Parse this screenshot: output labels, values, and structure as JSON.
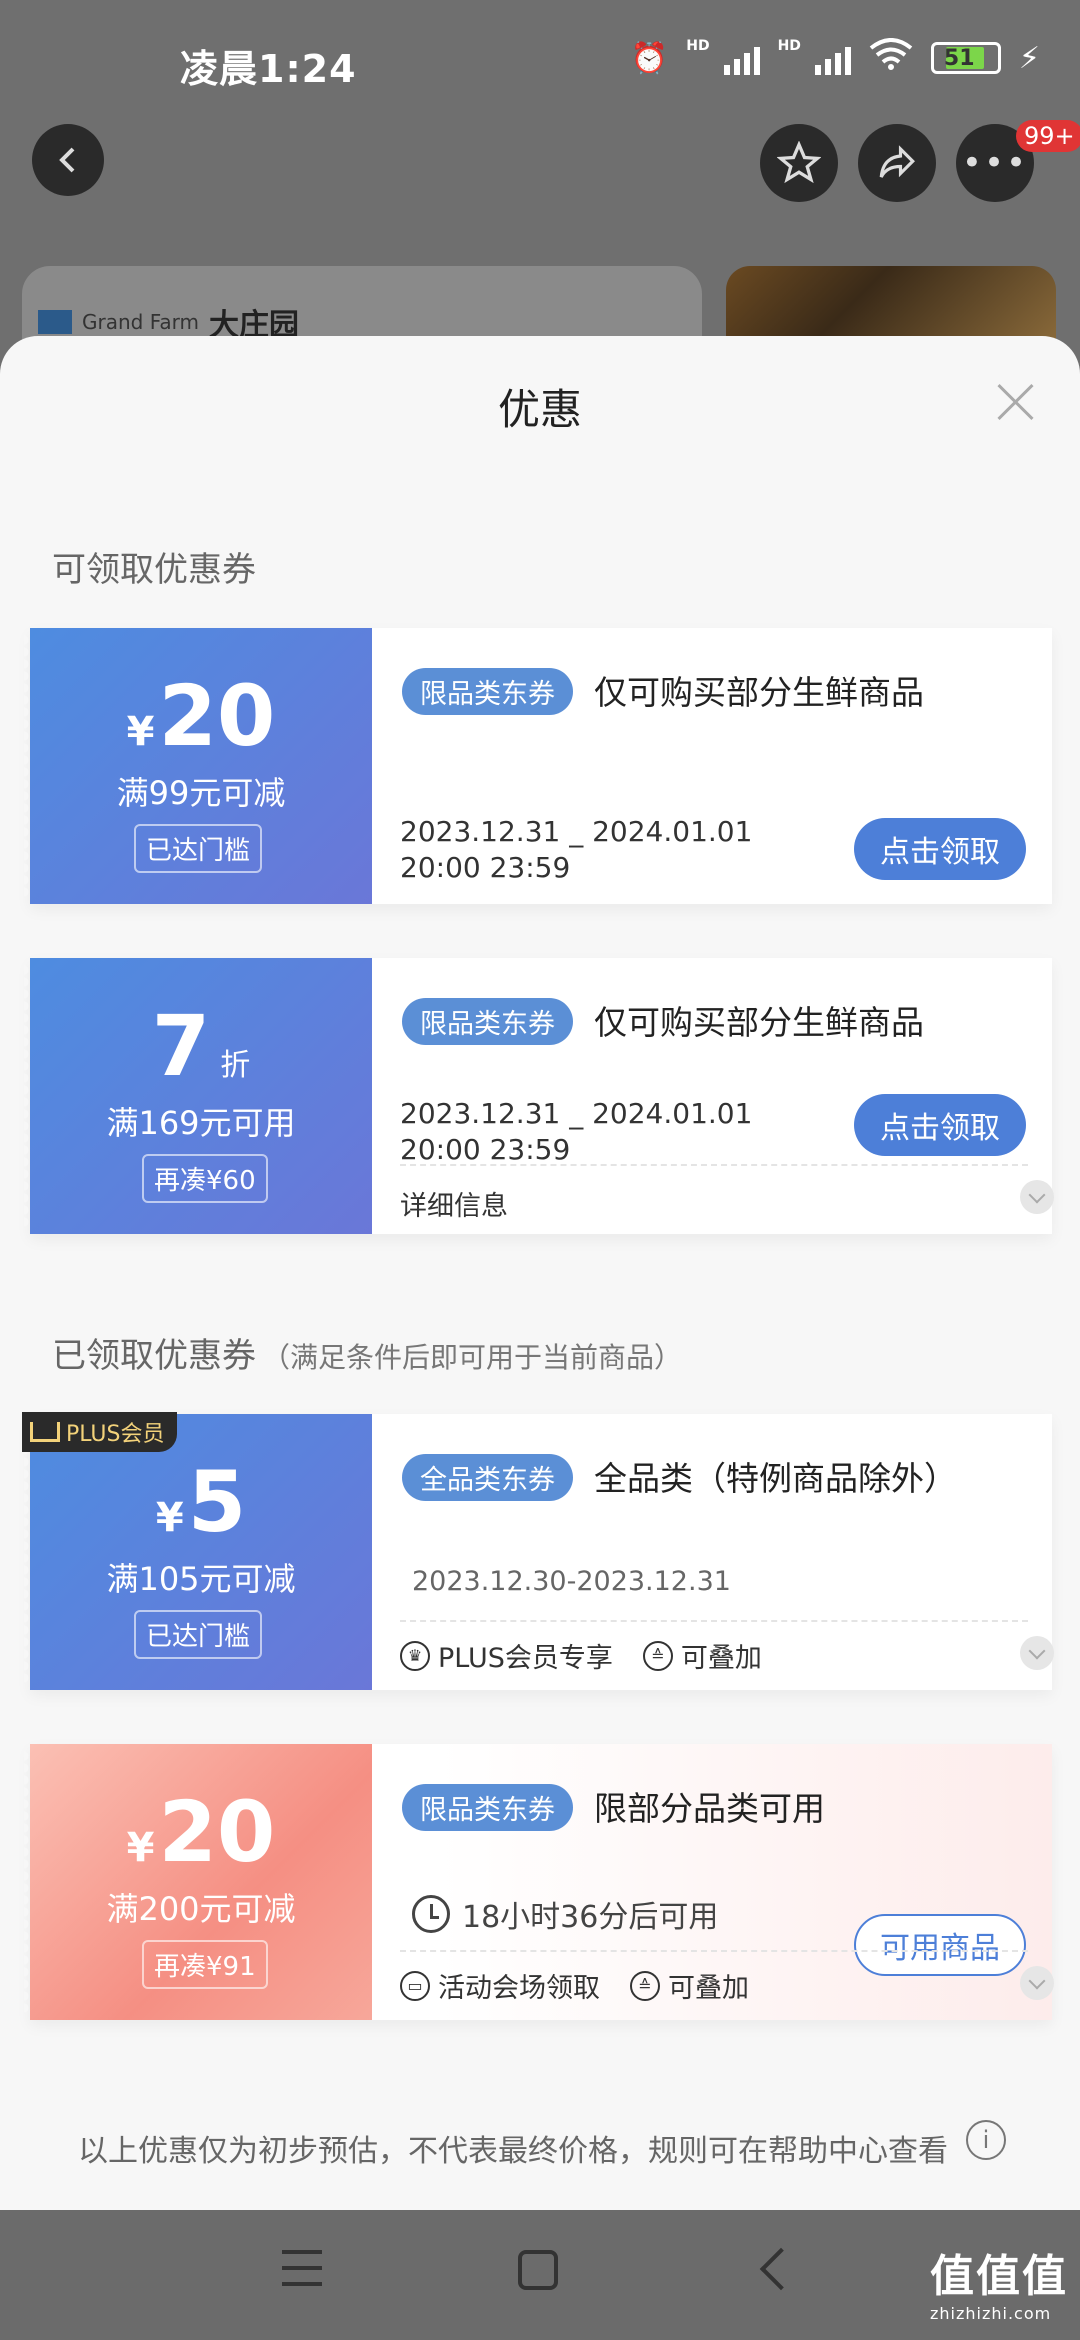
{
  "status_bar": {
    "time": "凌晨1:24",
    "battery": "51",
    "net_label": "HD"
  },
  "top_nav": {
    "badge": "99+"
  },
  "behind": {
    "logo_text": "Grand Farm",
    "brand": "大庄园"
  },
  "sheet": {
    "title": "优惠",
    "section_available": "可领取优惠券",
    "section_claimed": "已领取优惠券",
    "section_claimed_note": "（满足条件后即可用于当前商品）",
    "footer_note": "以上优惠仅为初步预估，不代表最终价格，规则可在帮助中心查看"
  },
  "coupons_available": [
    {
      "currency": "¥",
      "amount": "20",
      "suffix": "",
      "condition": "满99元可减",
      "tag": "已达门槛",
      "pill": "限品类东券",
      "desc": "仅可购买部分生鲜商品",
      "date_line1": "2023.12.31 _ 2024.01.01",
      "date_line2": "20:00 23:59",
      "button": "点击领取"
    },
    {
      "currency": "",
      "amount": "7",
      "suffix": "折",
      "condition": "满169元可用",
      "tag": "再凑¥60",
      "pill": "限品类东券",
      "desc": "仅可购买部分生鲜商品",
      "date_line1": "2023.12.31 _ 2024.01.01",
      "date_line2": "20:00 23:59",
      "button": "点击领取",
      "detail": "详细信息"
    }
  ],
  "coupons_claimed": [
    {
      "badge": "PLUS会员",
      "currency": "¥",
      "amount": "5",
      "condition": "满105元可减",
      "tag": "已达门槛",
      "pill": "全品类东券",
      "desc": "全品类（特例商品除外）",
      "date": "2023.12.30-2023.12.31",
      "feature1": "PLUS会员专享",
      "feature2": "可叠加"
    },
    {
      "currency": "¥",
      "amount": "20",
      "condition": "满200元可减",
      "tag": "再凑¥91",
      "pill": "限品类东券",
      "desc": "限部分品类可用",
      "timer": "18小时36分后可用",
      "button": "可用商品",
      "feature1": "活动会场领取",
      "feature2": "可叠加"
    }
  ],
  "watermark": {
    "title": "值值值",
    "site": "zhizhizhi.com"
  },
  "colors": {
    "accent": "#4d7fd8",
    "coupon_blue_start": "#4e8ce0",
    "coupon_blue_end": "#6a77d8",
    "coupon_pink": "#f58f83"
  }
}
